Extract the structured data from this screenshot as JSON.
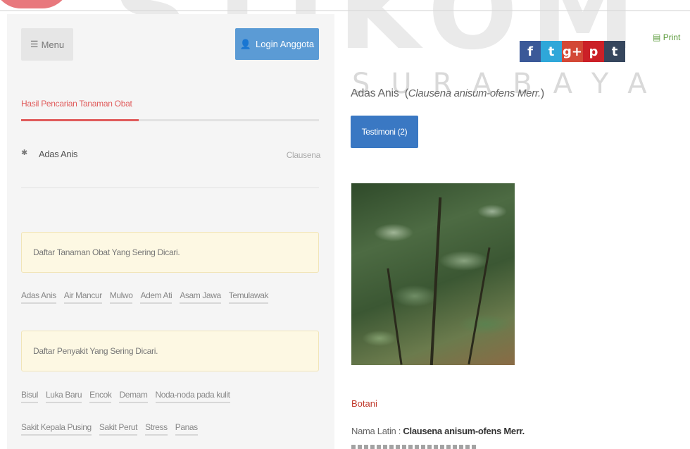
{
  "watermark": {
    "main": "STIKOM",
    "sub": "SURABAYA"
  },
  "header": {
    "menu_label": "Menu",
    "login_label": "Login Anggota",
    "print_label": "Print"
  },
  "social": [
    "f",
    "t",
    "g+",
    "p",
    "t"
  ],
  "search": {
    "tab_title": "Hasil Pencarian Tanaman Obat",
    "result": {
      "name": "Adas Anis",
      "latin_short": "Clausena"
    }
  },
  "popular_plants": {
    "title": "Daftar Tanaman Obat Yang Sering Dicari.",
    "items": [
      "Adas Anis",
      "Air Mancur",
      "Mulwo",
      "Adem Ati",
      "Asam Jawa",
      "Temulawak"
    ]
  },
  "popular_diseases": {
    "title": "Daftar Penyakit Yang Sering Dicari.",
    "items_row1": [
      "Bisul",
      "Luka Baru",
      "Encok",
      "Demam",
      "Noda-noda pada kulit"
    ],
    "items_row2": [
      "Sakit Kepala Pusing",
      "Sakit Perut",
      "Stress",
      "Panas"
    ]
  },
  "plant": {
    "name": "Adas Anis",
    "latin": "Clausena anisum-ofens Merr.",
    "testimoni_label": "Testimoni (2)",
    "section_title": "Botani",
    "latin_label": "Nama Latin : ",
    "latin_value": "Clausena anisum-ofens Merr."
  },
  "colors": {
    "accent": "#e05c5c",
    "login": "#5b9bd5",
    "testimoni": "#3a78c3",
    "alert_bg": "#fdf8e3"
  }
}
